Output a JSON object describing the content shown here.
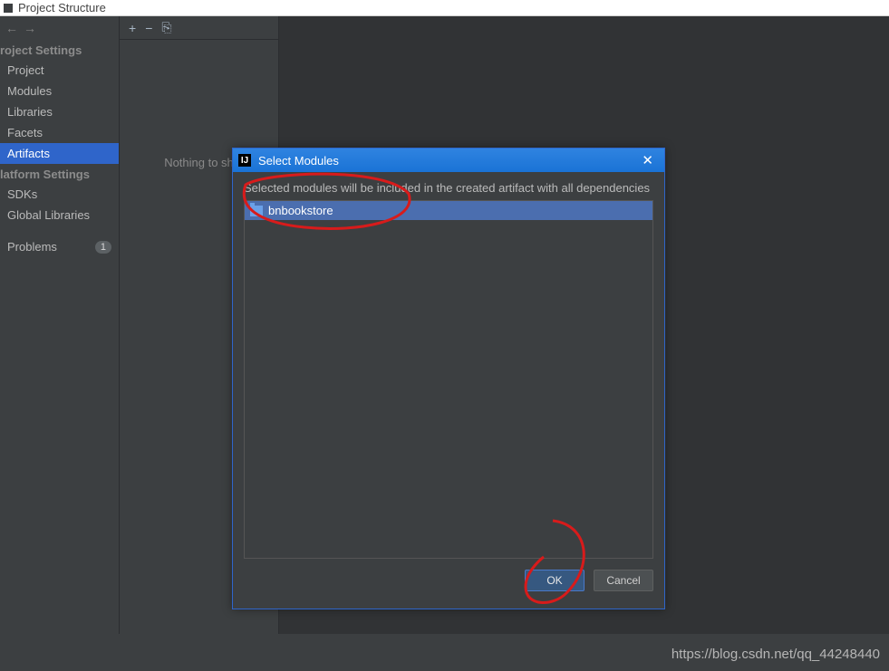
{
  "window": {
    "title": "Project Structure"
  },
  "nav": {
    "back": "←",
    "forward": "→"
  },
  "sidebar": {
    "section1": {
      "header": "roject Settings",
      "items": [
        "Project",
        "Modules",
        "Libraries",
        "Facets",
        "Artifacts"
      ],
      "selected": "Artifacts"
    },
    "section2": {
      "header": "latform Settings",
      "items": [
        "SDKs",
        "Global Libraries"
      ]
    },
    "problems": {
      "label": "Problems",
      "count": "1"
    }
  },
  "midpanel": {
    "tools": {
      "add": "+",
      "remove": "−",
      "copy": "⎘"
    },
    "empty": "Nothing to sh"
  },
  "dialog": {
    "title": "Select Modules",
    "info": "Selected modules will be included in the created artifact with all dependencies",
    "items": [
      "bnbookstore"
    ],
    "selected": "bnbookstore",
    "ok": "OK",
    "cancel": "Cancel"
  },
  "watermark": "https://blog.csdn.net/qq_44248440"
}
